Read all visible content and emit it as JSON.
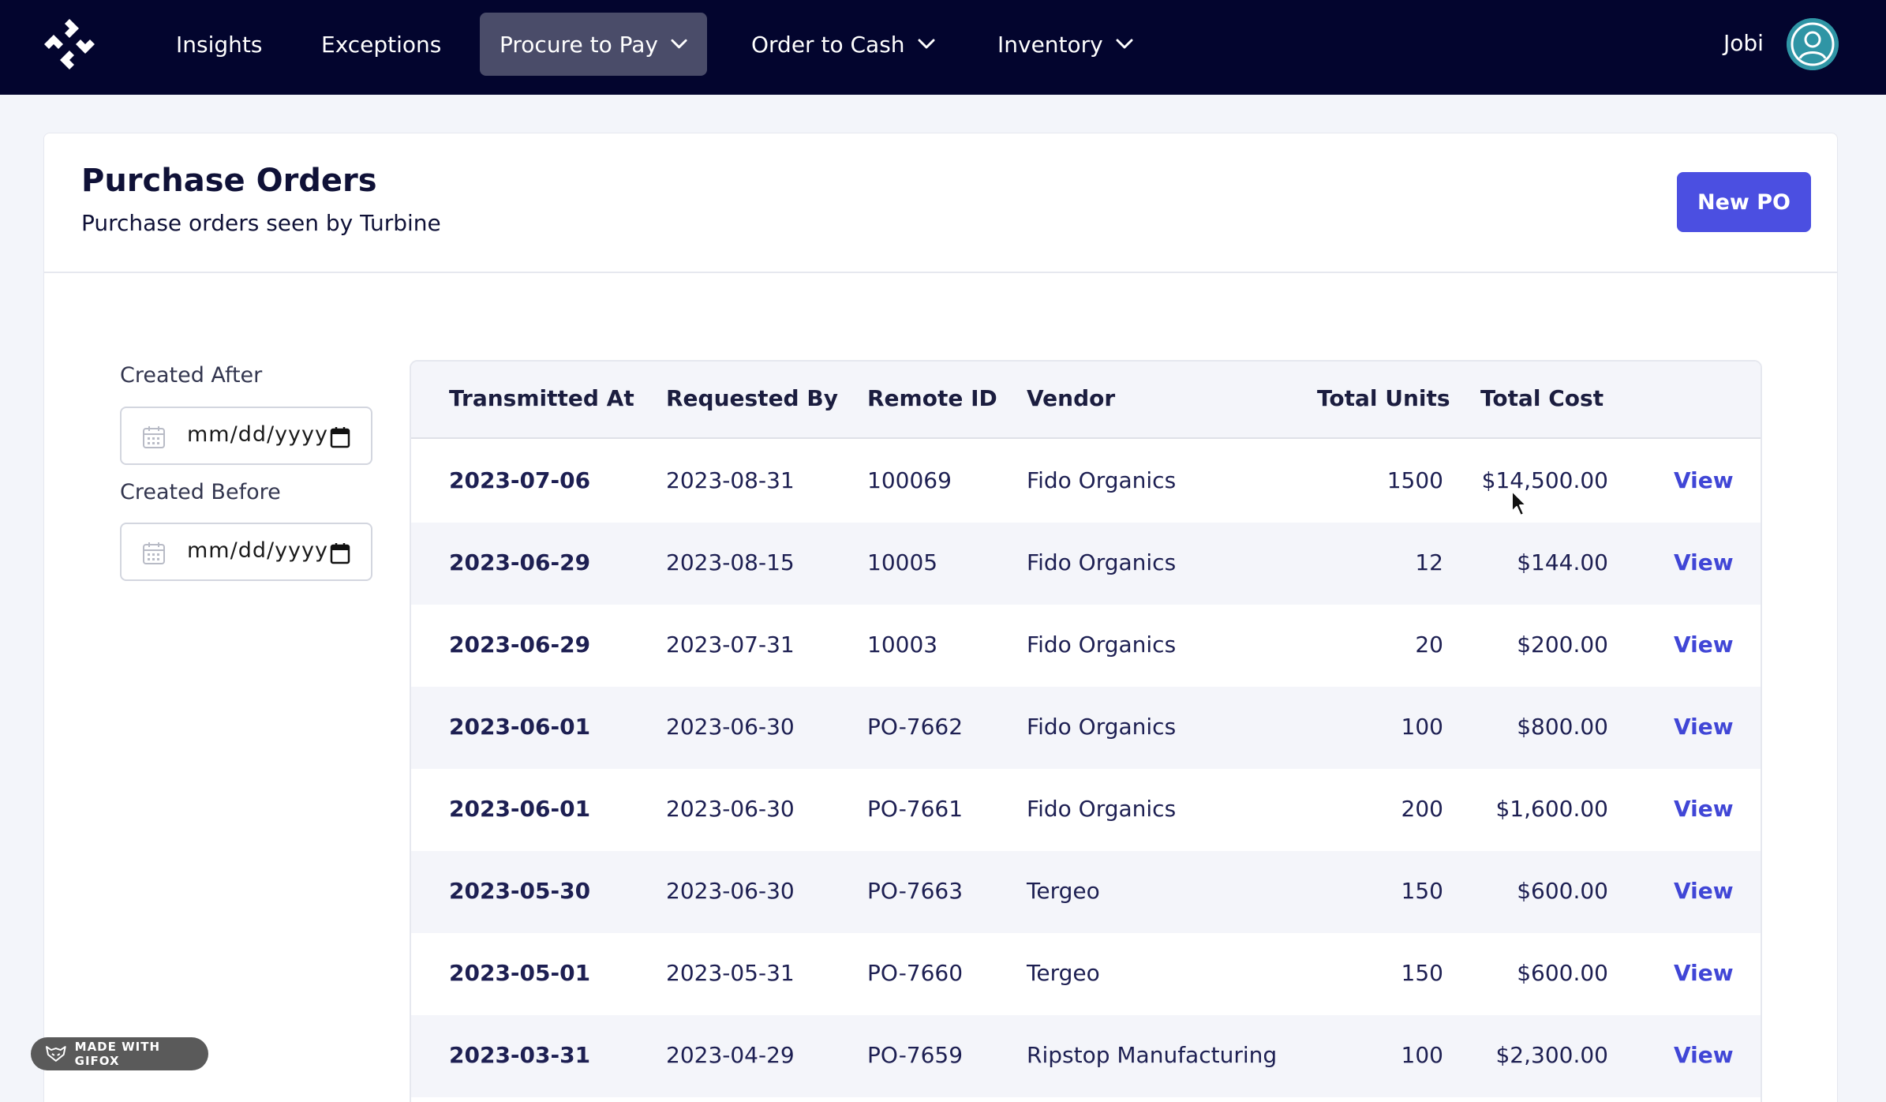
{
  "nav": {
    "items": [
      {
        "label": "Insights",
        "dropdown": false,
        "active": false
      },
      {
        "label": "Exceptions",
        "dropdown": false,
        "active": false
      },
      {
        "label": "Procure to Pay",
        "dropdown": true,
        "active": true
      },
      {
        "label": "Order to Cash",
        "dropdown": true,
        "active": false
      },
      {
        "label": "Inventory",
        "dropdown": true,
        "active": false
      }
    ],
    "user_name": "Jobi"
  },
  "page": {
    "title": "Purchase Orders",
    "subtitle": "Purchase orders seen by Turbine",
    "new_button": "New PO"
  },
  "filters": {
    "created_after_label": "Created After",
    "created_after_placeholder": "mm/dd/yyyy",
    "created_before_label": "Created Before",
    "created_before_placeholder": "mm/dd/yyyy"
  },
  "table": {
    "headers": [
      "Transmitted At",
      "Requested By",
      "Remote ID",
      "Vendor",
      "Total Units",
      "Total Cost"
    ],
    "rows": [
      {
        "transmitted_at": "2023-07-06",
        "requested_by": "2023-08-31",
        "remote_id": "100069",
        "vendor": "Fido Organics",
        "total_units": "1500",
        "total_cost": "$14,500.00",
        "action": "View"
      },
      {
        "transmitted_at": "2023-06-29",
        "requested_by": "2023-08-15",
        "remote_id": "10005",
        "vendor": "Fido Organics",
        "total_units": "12",
        "total_cost": "$144.00",
        "action": "View"
      },
      {
        "transmitted_at": "2023-06-29",
        "requested_by": "2023-07-31",
        "remote_id": "10003",
        "vendor": "Fido Organics",
        "total_units": "20",
        "total_cost": "$200.00",
        "action": "View"
      },
      {
        "transmitted_at": "2023-06-01",
        "requested_by": "2023-06-30",
        "remote_id": "PO-7662",
        "vendor": "Fido Organics",
        "total_units": "100",
        "total_cost": "$800.00",
        "action": "View"
      },
      {
        "transmitted_at": "2023-06-01",
        "requested_by": "2023-06-30",
        "remote_id": "PO-7661",
        "vendor": "Fido Organics",
        "total_units": "200",
        "total_cost": "$1,600.00",
        "action": "View"
      },
      {
        "transmitted_at": "2023-05-30",
        "requested_by": "2023-06-30",
        "remote_id": "PO-7663",
        "vendor": "Tergeo",
        "total_units": "150",
        "total_cost": "$600.00",
        "action": "View"
      },
      {
        "transmitted_at": "2023-05-01",
        "requested_by": "2023-05-31",
        "remote_id": "PO-7660",
        "vendor": "Tergeo",
        "total_units": "150",
        "total_cost": "$600.00",
        "action": "View"
      },
      {
        "transmitted_at": "2023-03-31",
        "requested_by": "2023-04-29",
        "remote_id": "PO-7659",
        "vendor": "Ripstop Manufacturing",
        "total_units": "100",
        "total_cost": "$2,300.00",
        "action": "View"
      }
    ]
  },
  "badge": {
    "label": "MADE WITH GIFOX",
    "icon": "fox-icon"
  },
  "colors": {
    "nav_bg": "#03052e",
    "nav_active": "#4a4c69",
    "accent": "#4b4fe1",
    "link": "#4046d6",
    "avatar": "#2f95a5"
  }
}
